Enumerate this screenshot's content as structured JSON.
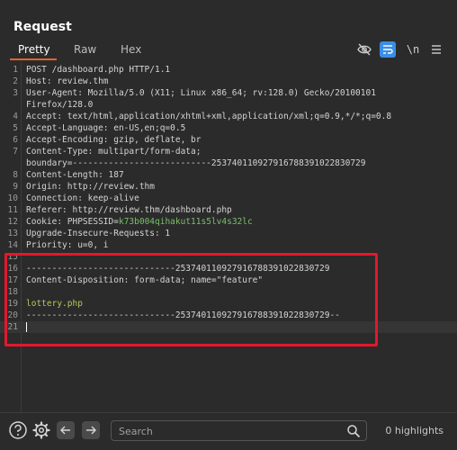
{
  "panel": {
    "title": "Request"
  },
  "tabs": [
    {
      "label": "Pretty",
      "active": true
    },
    {
      "label": "Raw",
      "active": false
    },
    {
      "label": "Hex",
      "active": false
    }
  ],
  "toolbar": {
    "hide_icon": "eye-slash-icon",
    "wrap_icon": "wrap-lines-icon",
    "newline_label": "\\n",
    "menu_icon": "hamburger-menu-icon"
  },
  "lines": [
    {
      "n": "1",
      "text": "POST /dashboard.php HTTP/1.1"
    },
    {
      "n": "2",
      "text": "Host: review.thm"
    },
    {
      "n": "3",
      "text": "User-Agent: Mozilla/5.0 (X11; Linux x86_64; rv:128.0) Gecko/20100101"
    },
    {
      "n": "",
      "text": "Firefox/128.0"
    },
    {
      "n": "4",
      "text": "Accept: text/html,application/xhtml+xml,application/xml;q=0.9,*/*;q=0.8"
    },
    {
      "n": "5",
      "text": "Accept-Language: en-US,en;q=0.5"
    },
    {
      "n": "6",
      "text": "Accept-Encoding: gzip, deflate, br"
    },
    {
      "n": "7",
      "text": "Content-Type: multipart/form-data;"
    },
    {
      "n": "",
      "text": "boundary=---------------------------253740110927916788391022830729"
    },
    {
      "n": "8",
      "text": "Content-Length: 187"
    },
    {
      "n": "9",
      "text": "Origin: http://review.thm"
    },
    {
      "n": "10",
      "text": "Connection: keep-alive"
    },
    {
      "n": "11",
      "text": "Referer: http://review.thm/dashboard.php"
    },
    {
      "n": "12",
      "cookie": true,
      "prefix": "Cookie: ",
      "name": "PHPSESSID",
      "eq": "=",
      "value": "k73b004qihakut11s5lv4s32lc"
    },
    {
      "n": "13",
      "text": "Upgrade-Insecure-Requests: 1"
    },
    {
      "n": "14",
      "text": "Priority: u=0, i"
    },
    {
      "n": "15",
      "text": ""
    },
    {
      "n": "16",
      "text": "-----------------------------253740110927916788391022830729"
    },
    {
      "n": "17",
      "text": "Content-Disposition: form-data; name=\"feature\""
    },
    {
      "n": "18",
      "text": ""
    },
    {
      "n": "19",
      "text": "lottery.php",
      "green": true
    },
    {
      "n": "20",
      "text": "-----------------------------253740110927916788391022830729--"
    },
    {
      "n": "21",
      "text": "",
      "cursor": true
    }
  ],
  "bottom": {
    "help_icon": "help-circle-icon",
    "settings_icon": "gear-icon",
    "back_icon": "arrow-left-icon",
    "forward_icon": "arrow-right-icon",
    "search_placeholder": "Search",
    "highlights_text": "0 highlights"
  },
  "colors": {
    "accent": "#e8622c",
    "highlight_box": "#e3182d",
    "active_tool": "#3a8ee6",
    "cookie_value": "#7bbf6a",
    "body_text": "#b6c95a"
  }
}
